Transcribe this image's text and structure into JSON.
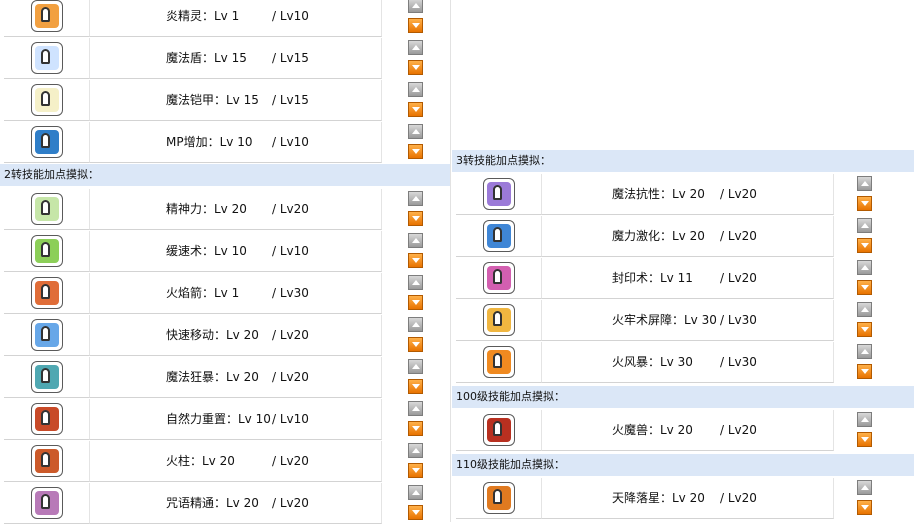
{
  "left_panel": {
    "rows_top": [
      {
        "name": "炎精灵：Lv 1",
        "max": "/ Lv10",
        "icon": "flame-spirit-icon",
        "color": "#f2a040"
      },
      {
        "name": "魔法盾：Lv 15",
        "max": "/ Lv15",
        "icon": "magic-shield-icon",
        "color": "#cfe3ff"
      },
      {
        "name": "魔法铠甲：Lv 15",
        "max": "/ Lv15",
        "icon": "magic-armor-icon",
        "color": "#f5f0c8"
      },
      {
        "name": "MP增加：Lv 10",
        "max": "/ Lv10",
        "icon": "mp-increase-icon",
        "color": "#2f7ec8"
      }
    ],
    "section2_title": "2转技能加点摸拟：",
    "rows_section2": [
      {
        "name": "精神力：Lv 20",
        "max": "/ Lv20",
        "icon": "meditation-icon",
        "color": "#c6e6a8"
      },
      {
        "name": "缓速术：Lv 10",
        "max": "/ Lv10",
        "icon": "slow-icon",
        "color": "#8ccf58"
      },
      {
        "name": "火焰箭：Lv 1",
        "max": "/ Lv30",
        "icon": "fire-arrow-icon",
        "color": "#e06d38"
      },
      {
        "name": "快速移动：Lv 20",
        "max": "/ Lv20",
        "icon": "teleport-icon",
        "color": "#67a7e8"
      },
      {
        "name": "魔法狂暴：Lv 20",
        "max": "/ Lv20",
        "icon": "spell-booster-icon",
        "color": "#4fa8b2"
      },
      {
        "name": "自然力重置：Lv 10",
        "max": "/ Lv10",
        "icon": "element-reset-icon",
        "color": "#c84a28"
      },
      {
        "name": "火柱：Lv 20",
        "max": "/ Lv20",
        "icon": "fire-pillar-icon",
        "color": "#cc5a2a"
      },
      {
        "name": "咒语精通：Lv 20",
        "max": "/ Lv20",
        "icon": "spell-mastery-icon",
        "color": "#b87ab8"
      }
    ]
  },
  "right_panel": {
    "section3_title": "3转技能加点摸拟：",
    "rows_section3": [
      {
        "name": "魔法抗性：Lv 20",
        "max": "/ Lv20",
        "icon": "magic-resistance-icon",
        "color": "#9b7ad8"
      },
      {
        "name": "魔力激化：Lv 20",
        "max": "/ Lv20",
        "icon": "magic-amplification-icon",
        "color": "#3f86d6"
      },
      {
        "name": "封印术：Lv 11",
        "max": "/ Lv20",
        "icon": "seal-icon",
        "color": "#d35fb0"
      },
      {
        "name": "火牢术屏障：Lv 30",
        "max": "/ Lv30",
        "icon": "fire-barrier-icon",
        "color": "#f0b640"
      },
      {
        "name": "火风暴：Lv 30",
        "max": "/ Lv30",
        "icon": "fire-storm-icon",
        "color": "#f08a20"
      }
    ],
    "section100_title": "100级技能加点摸拟：",
    "rows_section100": [
      {
        "name": "火魔兽：Lv 20",
        "max": "/ Lv20",
        "icon": "ifrit-icon",
        "color": "#b83020"
      }
    ],
    "section110_title": "110级技能加点摸拟：",
    "rows_section110": [
      {
        "name": "天降落星：Lv 20",
        "max": "/ Lv20",
        "icon": "meteor-icon",
        "color": "#e07a20"
      }
    ]
  }
}
